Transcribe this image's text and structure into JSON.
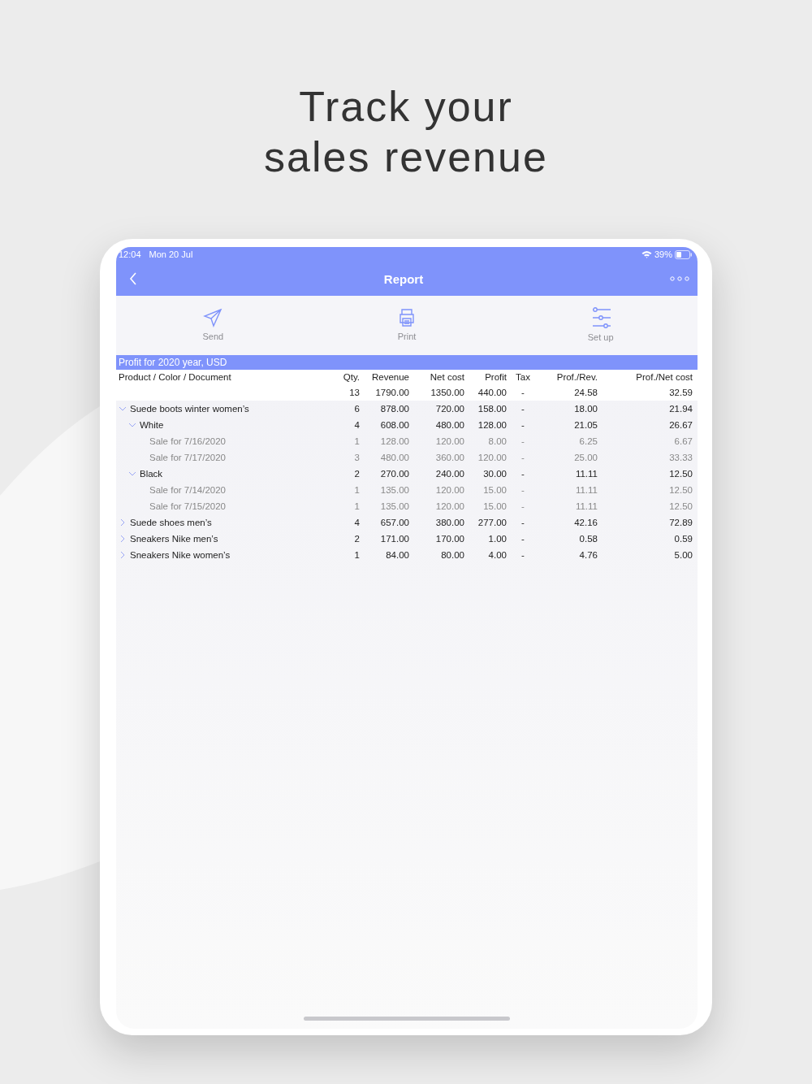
{
  "headline": [
    "Track your",
    "sales revenue"
  ],
  "status_bar": {
    "time": "12:04",
    "date": "Mon 20 Jul",
    "battery": "39%"
  },
  "nav": {
    "title": "Report"
  },
  "toolbar": [
    {
      "kind": "send",
      "label": "Send"
    },
    {
      "kind": "print",
      "label": "Print"
    },
    {
      "kind": "setup",
      "label": "Set up"
    }
  ],
  "report": {
    "title": "Profit for 2020 year, USD",
    "columns": [
      "Product / Color / Document",
      "Qty.",
      "Revenue",
      "Net cost",
      "Profit",
      "Tax",
      "Prof./Rev.",
      "Prof./Net cost"
    ],
    "totals": [
      "13",
      "1790.00",
      "1350.00",
      "440.00",
      "-",
      "24.58",
      "32.59"
    ],
    "rows": [
      {
        "name": "Suede boots winter women’s",
        "values": [
          "6",
          "878.00",
          "720.00",
          "158.00",
          "-",
          "18.00",
          "21.94"
        ],
        "expanded": true,
        "children": [
          {
            "name": "White",
            "values": [
              "4",
              "608.00",
              "480.00",
              "128.00",
              "-",
              "21.05",
              "26.67"
            ],
            "expanded": true,
            "children": [
              {
                "name": "Sale for 7/16/2020",
                "values": [
                  "1",
                  "128.00",
                  "120.00",
                  "8.00",
                  "-",
                  "6.25",
                  "6.67"
                ]
              },
              {
                "name": "Sale for 7/17/2020",
                "values": [
                  "3",
                  "480.00",
                  "360.00",
                  "120.00",
                  "-",
                  "25.00",
                  "33.33"
                ]
              }
            ]
          },
          {
            "name": "Black",
            "values": [
              "2",
              "270.00",
              "240.00",
              "30.00",
              "-",
              "11.11",
              "12.50"
            ],
            "expanded": true,
            "children": [
              {
                "name": "Sale for 7/14/2020",
                "values": [
                  "1",
                  "135.00",
                  "120.00",
                  "15.00",
                  "-",
                  "11.11",
                  "12.50"
                ]
              },
              {
                "name": "Sale for 7/15/2020",
                "values": [
                  "1",
                  "135.00",
                  "120.00",
                  "15.00",
                  "-",
                  "11.11",
                  "12.50"
                ]
              }
            ]
          }
        ]
      },
      {
        "name": "Suede shoes men’s",
        "values": [
          "4",
          "657.00",
          "380.00",
          "277.00",
          "-",
          "42.16",
          "72.89"
        ],
        "expanded": false
      },
      {
        "name": "Sneakers Nike men’s",
        "values": [
          "2",
          "171.00",
          "170.00",
          "1.00",
          "-",
          "0.58",
          "0.59"
        ],
        "expanded": false
      },
      {
        "name": "Sneakers Nike women’s",
        "values": [
          "1",
          "84.00",
          "80.00",
          "4.00",
          "-",
          "4.76",
          "5.00"
        ],
        "expanded": false
      }
    ]
  }
}
